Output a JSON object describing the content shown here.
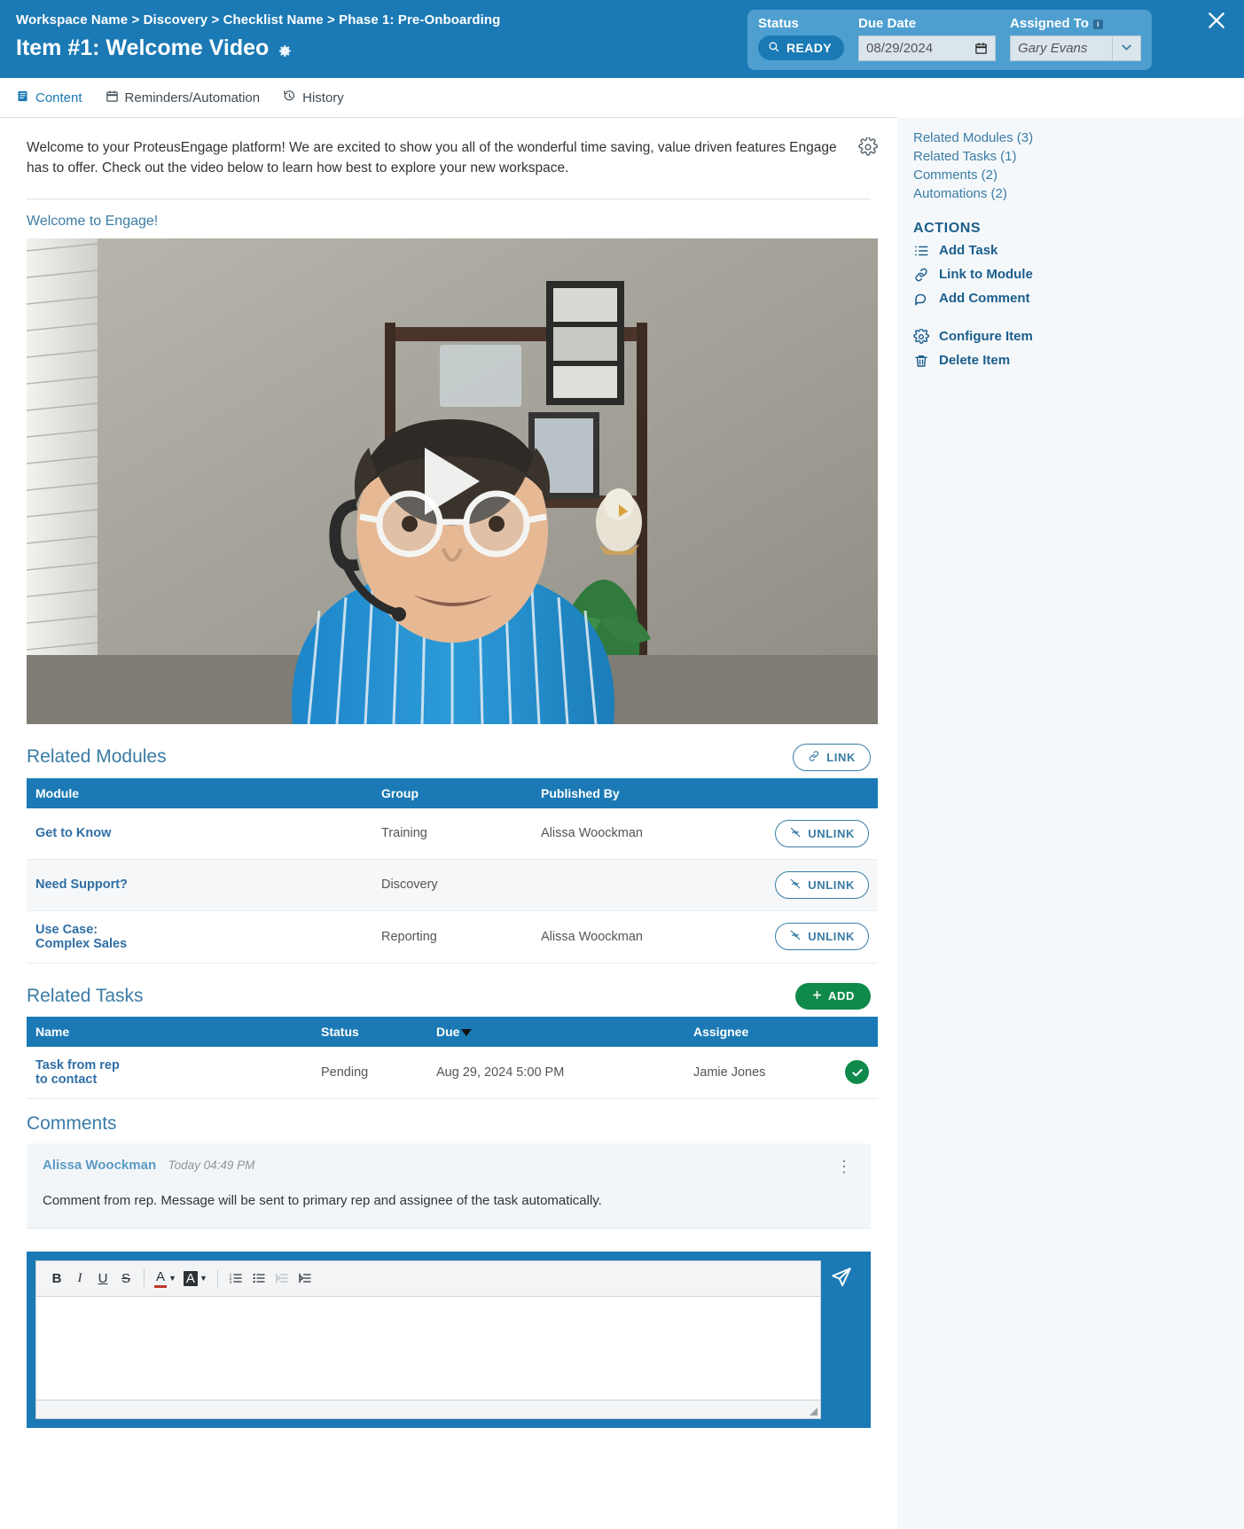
{
  "header": {
    "breadcrumb": "Workspace Name > Discovery > Checklist Name > Phase 1: Pre-Onboarding",
    "title": "Item #1: Welcome Video",
    "title_gear_icon": "gear-icon",
    "close_icon": "close-icon",
    "status_label": "Status",
    "status_value": "READY",
    "status_icon": "ready-icon",
    "due_label": "Due Date",
    "due_value": "08/29/2024",
    "calendar_icon": "calendar-icon",
    "assigned_label": "Assigned To",
    "assigned_info_icon": "info-icon",
    "assigned_value": "Gary Evans",
    "assigned_chevron_icon": "chevron-down-icon",
    "accent_color": "#1b7ab5"
  },
  "tabs": [
    {
      "label": "Content",
      "icon": "document-icon",
      "active": true
    },
    {
      "label": "Reminders/Automation",
      "icon": "calendar-icon",
      "active": false
    },
    {
      "label": "History",
      "icon": "history-clock-icon",
      "active": false
    }
  ],
  "sidebar": {
    "links": [
      {
        "label": "Related Modules (3)"
      },
      {
        "label": "Related Tasks (1)"
      },
      {
        "label": "Comments (2)"
      },
      {
        "label": "Automations (2)"
      }
    ],
    "actions_title": "ACTIONS",
    "actions": [
      {
        "label": "Add Task",
        "icon": "list-icon"
      },
      {
        "label": "Link to Module",
        "icon": "link-icon"
      },
      {
        "label": "Add Comment",
        "icon": "comment-icon"
      }
    ],
    "actions_secondary": [
      {
        "label": "Configure Item",
        "icon": "gear-icon"
      },
      {
        "label": "Delete Item",
        "icon": "trash-icon"
      }
    ]
  },
  "content": {
    "description": "Welcome to your ProteusEngage platform! We are excited to show you all of the wonderful time saving, value driven features Engage has to offer. Check out the video below to learn how best to explore your new workspace.",
    "settings_gear_icon": "gear-icon",
    "video_title": "Welcome to Engage!",
    "play_icon": "play-icon"
  },
  "related_modules": {
    "title": "Related Modules",
    "link_button": "LINK",
    "link_button_icon": "link-icon",
    "unlink_label": "UNLINK",
    "unlink_icon": "unlink-icon",
    "columns": [
      "Module",
      "Group",
      "Published By",
      ""
    ],
    "rows": [
      {
        "module": "Get to Know",
        "group": "Training",
        "published_by": "Alissa Woockman"
      },
      {
        "module": "Need Support?",
        "group": "Discovery",
        "published_by": ""
      },
      {
        "module": "Use Case:\nComplex Sales",
        "group": "Reporting",
        "published_by": "Alissa Woockman"
      }
    ]
  },
  "related_tasks": {
    "title": "Related Tasks",
    "add_button": "ADD",
    "add_button_icon": "plus-icon",
    "columns": [
      "Name",
      "Status",
      "Due",
      "Assignee",
      ""
    ],
    "sort_column": "Due",
    "sort_icon": "sort-descending-caret",
    "complete_icon": "check-circle-icon",
    "rows": [
      {
        "name": "Task from rep\nto contact",
        "status": "Pending",
        "due": "Aug 29, 2024 5:00 PM",
        "assignee": "Jamie Jones"
      }
    ]
  },
  "comments": {
    "title": "Comments",
    "items": [
      {
        "author": "Alissa Woockman",
        "time": "Today 04:49 PM",
        "body": "Comment from rep. Message will be sent to primary rep and assignee of the task automatically.",
        "menu_icon": "kebab-menu-icon"
      }
    ]
  },
  "editor": {
    "value": "",
    "placeholder": "",
    "send_icon": "send-icon",
    "toolbar": [
      {
        "label": "B",
        "name": "bold-button",
        "disabled": false
      },
      {
        "label": "I",
        "name": "italic-button",
        "disabled": false
      },
      {
        "label": "U",
        "name": "underline-button",
        "disabled": false
      },
      {
        "label": "S",
        "name": "strikethrough-button",
        "disabled": false
      },
      {
        "label": "A",
        "name": "text-color-button",
        "disabled": false
      },
      {
        "label": "A",
        "name": "highlight-color-button",
        "disabled": false
      },
      {
        "label": "",
        "name": "numbered-list-button",
        "disabled": false
      },
      {
        "label": "",
        "name": "bullet-list-button",
        "disabled": false
      },
      {
        "label": "",
        "name": "outdent-button",
        "disabled": true
      },
      {
        "label": "",
        "name": "indent-button",
        "disabled": false
      }
    ]
  }
}
